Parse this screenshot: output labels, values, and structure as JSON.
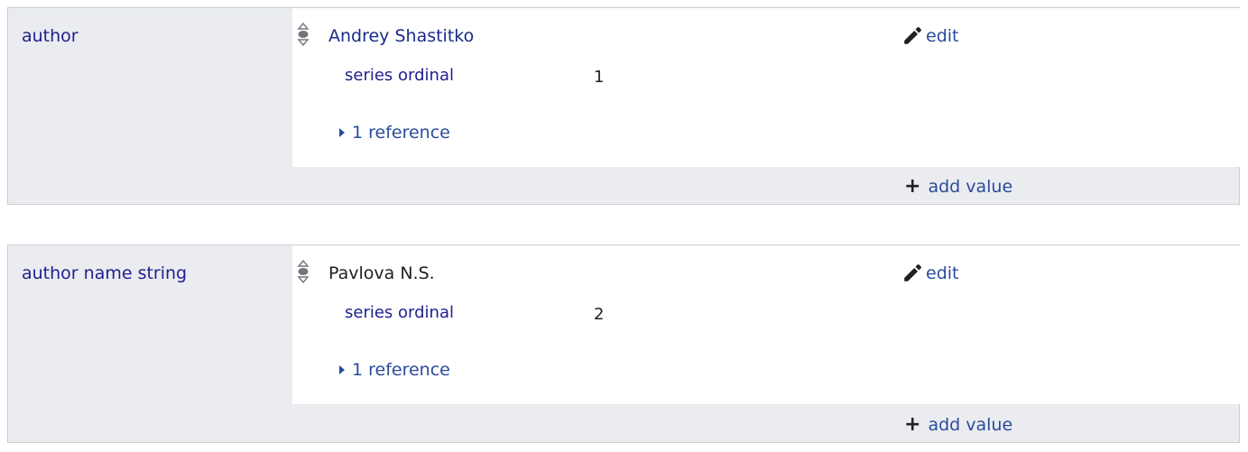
{
  "statements": [
    {
      "property": "author",
      "value": "Andrey Shastitko",
      "value_is_link": true,
      "edit_label": "edit",
      "qualifier": {
        "label": "series ordinal",
        "value": "1"
      },
      "references_label": "1 reference",
      "add_value_label": "add value",
      "rank_icon": "normal-rank-icon"
    },
    {
      "property": "author name string",
      "value": "Pavlova N.S.",
      "value_is_link": false,
      "edit_label": "edit",
      "qualifier": {
        "label": "series ordinal",
        "value": "2"
      },
      "references_label": "1 reference",
      "add_value_label": "add value",
      "rank_icon": "normal-rank-icon"
    }
  ],
  "colors": {
    "link": "#2a4b9b",
    "label": "#202090",
    "group_bg": "#eaecf0",
    "border": "#c8ccd1"
  }
}
